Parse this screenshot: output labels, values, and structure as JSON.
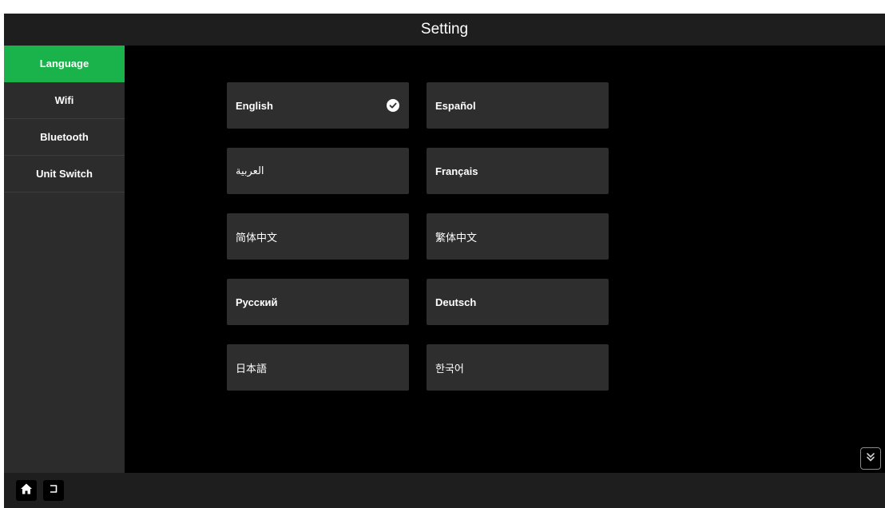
{
  "header": {
    "title": "Setting"
  },
  "sidebar": {
    "items": [
      {
        "label": "Language",
        "active": true
      },
      {
        "label": "Wifi",
        "active": false
      },
      {
        "label": "Bluetooth",
        "active": false
      },
      {
        "label": "Unit Switch",
        "active": false
      }
    ]
  },
  "languages": [
    {
      "label": "English",
      "selected": true
    },
    {
      "label": "Español",
      "selected": false
    },
    {
      "label": "العربية",
      "selected": false
    },
    {
      "label": "Français",
      "selected": false
    },
    {
      "label": "简体中文",
      "selected": false
    },
    {
      "label": "繁体中文",
      "selected": false
    },
    {
      "label": "Русский",
      "selected": false
    },
    {
      "label": "Deutsch",
      "selected": false
    },
    {
      "label": "日本語",
      "selected": false
    },
    {
      "label": "한국어",
      "selected": false
    }
  ],
  "icons": {
    "check": "check-circle-icon",
    "expand": "double-chevron-down-icon",
    "home": "home-icon",
    "back": "back-icon"
  },
  "colors": {
    "accent": "#1ab24a",
    "background": "#000000",
    "panel": "#2e2e2e",
    "sidebar": "#2c2c2c",
    "bar": "#1e1e1e"
  }
}
